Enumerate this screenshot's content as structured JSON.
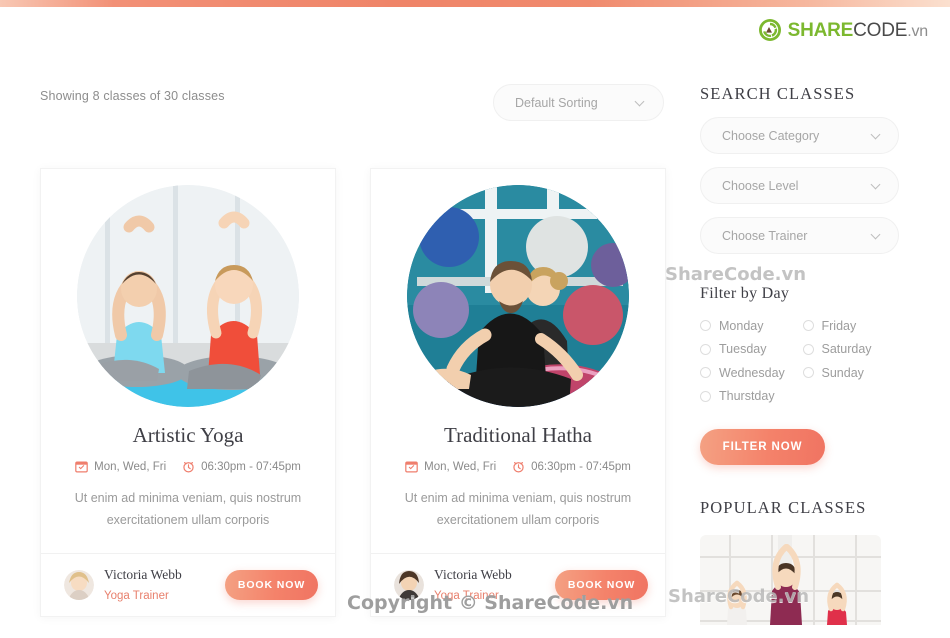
{
  "brand": {
    "share": "SHARE",
    "code": "CODE",
    "vn": ".vn",
    "logo_green": "#7cb82f"
  },
  "toolbar": {
    "showing": "Showing 8 classes of 30 classes",
    "sorting_value": "Default Sorting"
  },
  "cards": [
    {
      "title": "Artistic Yoga",
      "days": "Mon, Wed, Fri",
      "time": "06:30pm - 07:45pm",
      "desc": "Ut enim ad minima veniam, quis nostrum exercitationem ullam corporis",
      "trainer_name": "Victoria Webb",
      "trainer_role": "Yoga Trainer",
      "book_label": "BOOK NOW"
    },
    {
      "title": "Traditional Hatha",
      "days": "Mon, Wed, Fri",
      "time": "06:30pm - 07:45pm",
      "desc": "Ut enim ad minima veniam, quis nostrum exercitationem ullam corporis",
      "trainer_name": "Victoria Webb",
      "trainer_role": "Yoga Trainer",
      "book_label": "BOOK NOW"
    }
  ],
  "sidebar": {
    "search_heading": "SEARCH CLASSES",
    "selects": [
      {
        "label": "Choose Category"
      },
      {
        "label": "Choose Level"
      },
      {
        "label": "Choose Trainer"
      }
    ],
    "filter_heading": "Filter by Day",
    "days": [
      "Monday",
      "Friday",
      "Tuesday",
      "Saturday",
      "Wednesday",
      "Sunday",
      "Thurstday"
    ],
    "filter_button": "FILTER NOW",
    "popular_heading": "POPULAR CLASSES"
  },
  "watermarks": {
    "w1": "ShareCode.vn",
    "w2": "Copyright © ShareCode.vn",
    "w3": "ShareCode.vn"
  },
  "accent": {
    "orange": "#f08468",
    "pink_text": "#e8806d",
    "green": "#7cb82f"
  }
}
